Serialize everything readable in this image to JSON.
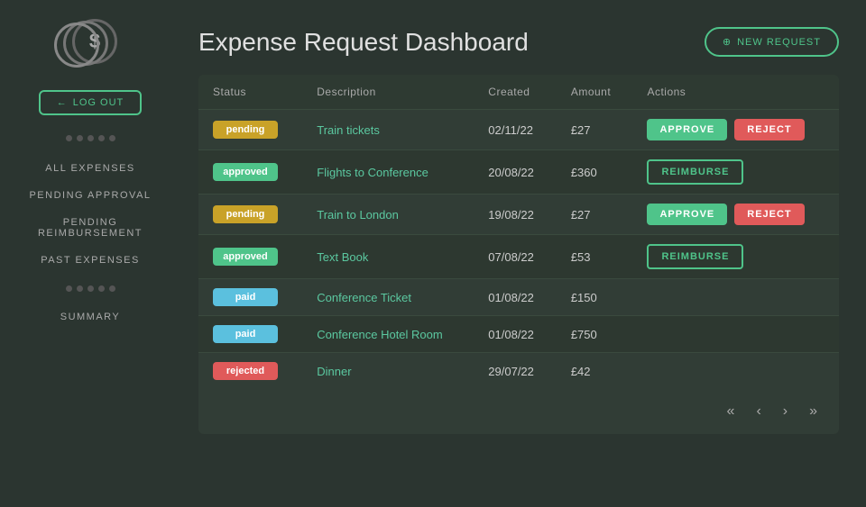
{
  "sidebar": {
    "logout_label": "LOG OUT",
    "nav_items": [
      {
        "id": "all-expenses",
        "label": "ALL EXPENSES"
      },
      {
        "id": "pending-approval",
        "label": "PENDING APPROVAL"
      },
      {
        "id": "pending-reimbursement",
        "label": "PENDING REIMBURSEMENT"
      },
      {
        "id": "past-expenses",
        "label": "PAST EXPENSES"
      },
      {
        "id": "summary",
        "label": "SUMMARY"
      }
    ]
  },
  "header": {
    "title": "Expense Request Dashboard",
    "new_request_label": "NEW REQUEST"
  },
  "table": {
    "columns": [
      "Status",
      "Description",
      "Created",
      "Amount",
      "Actions"
    ],
    "rows": [
      {
        "status": "pending",
        "status_class": "status-pending",
        "description": "Train tickets",
        "created": "02/11/22",
        "amount": "£27",
        "actions": [
          "approve",
          "reject"
        ]
      },
      {
        "status": "approved",
        "status_class": "status-approved",
        "description": "Flights to Conference",
        "created": "20/08/22",
        "amount": "£360",
        "actions": [
          "reimburse"
        ]
      },
      {
        "status": "pending",
        "status_class": "status-pending",
        "description": "Train to London",
        "created": "19/08/22",
        "amount": "£27",
        "actions": [
          "approve",
          "reject"
        ]
      },
      {
        "status": "approved",
        "status_class": "status-approved",
        "description": "Text Book",
        "created": "07/08/22",
        "amount": "£53",
        "actions": [
          "reimburse"
        ]
      },
      {
        "status": "paid",
        "status_class": "status-paid",
        "description": "Conference Ticket",
        "created": "01/08/22",
        "amount": "£150",
        "actions": []
      },
      {
        "status": "paid",
        "status_class": "status-paid",
        "description": "Conference Hotel Room",
        "created": "01/08/22",
        "amount": "£750",
        "actions": []
      },
      {
        "status": "rejected",
        "status_class": "status-rejected",
        "description": "Dinner",
        "created": "29/07/22",
        "amount": "£42",
        "actions": []
      }
    ],
    "action_labels": {
      "approve": "APPROVE",
      "reject": "REJECT",
      "reimburse": "REIMBURSE"
    }
  },
  "pagination": {
    "first": "«",
    "prev": "‹",
    "next": "›",
    "last": "»"
  }
}
